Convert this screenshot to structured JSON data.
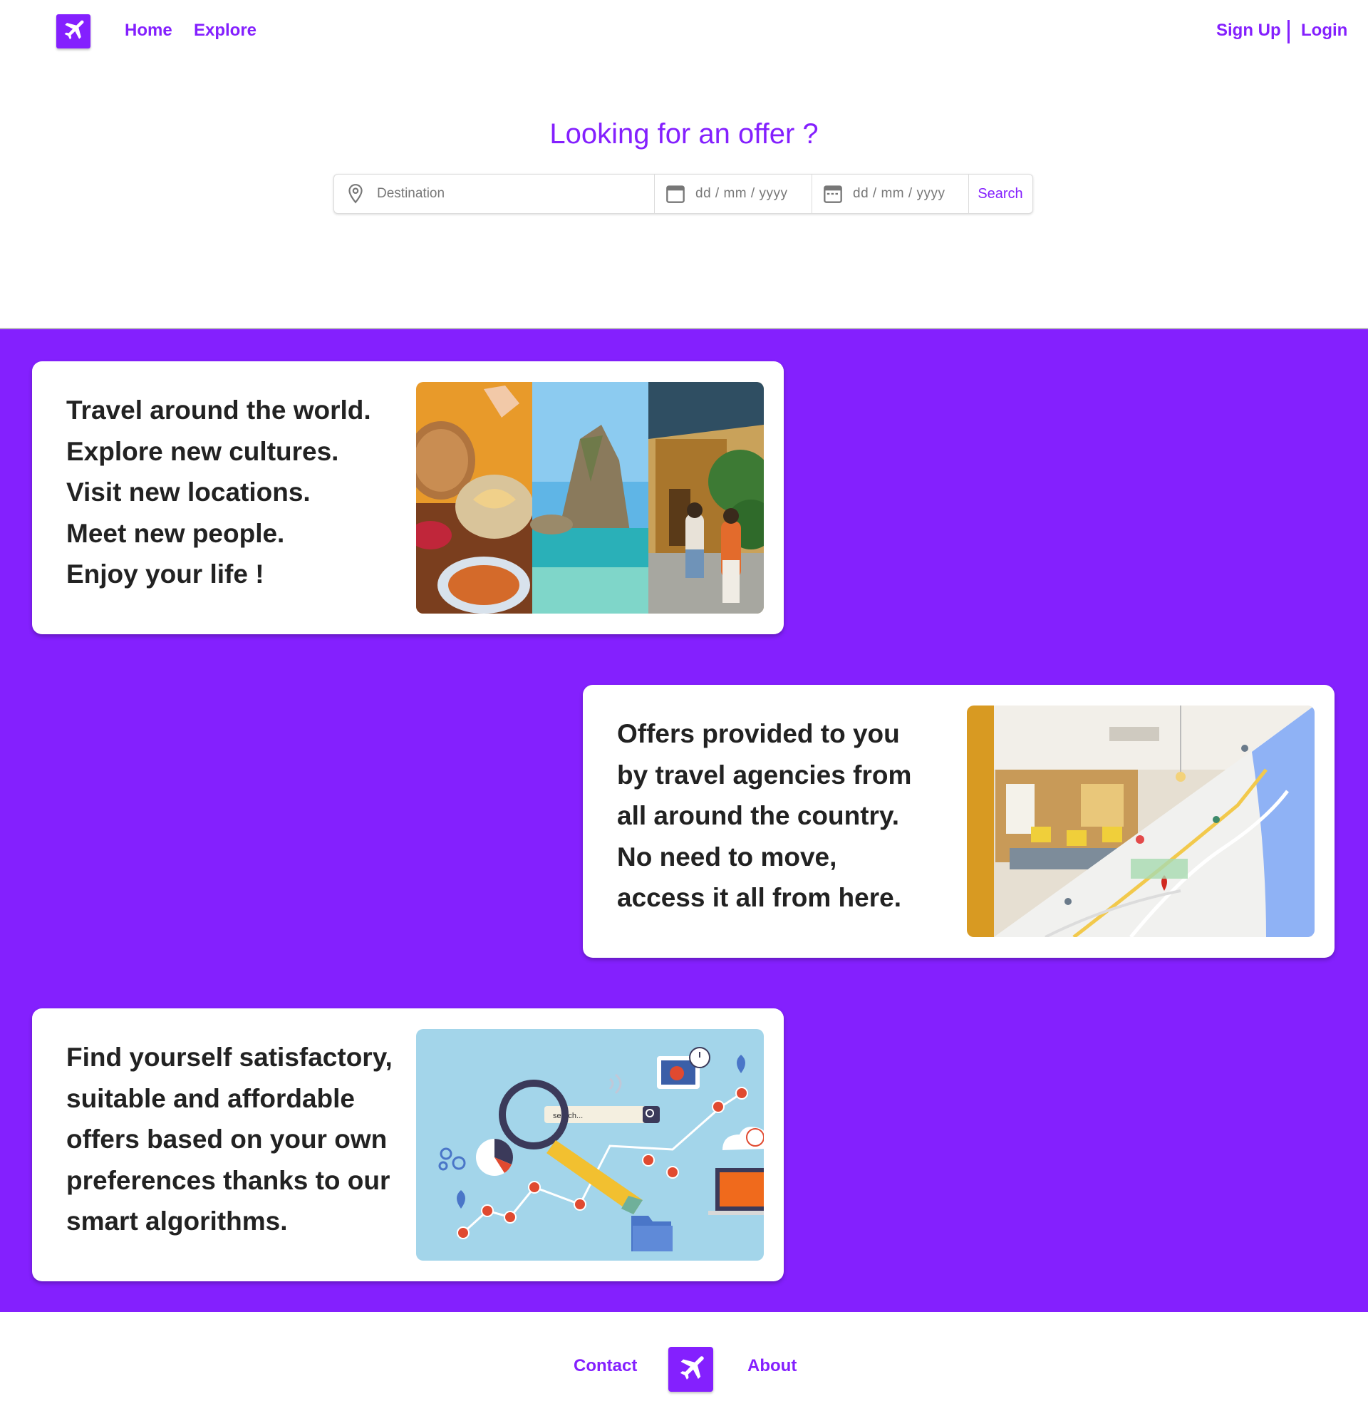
{
  "header": {
    "logo_icon": "airplane-icon",
    "nav": [
      {
        "label": "Home"
      },
      {
        "label": "Explore"
      }
    ],
    "signup_label": "Sign Up",
    "login_label": "Login"
  },
  "hero": {
    "title": "Looking for an offer ?",
    "search": {
      "destination_placeholder": "Destination",
      "start_date_placeholder": "dd / mm / yyyy",
      "end_date_placeholder": "dd / mm / yyyy",
      "button_label": "Search",
      "destination_icon": "location-pin-icon",
      "start_date_icon": "calendar-icon",
      "end_date_icon": "calendar-range-icon"
    }
  },
  "features": [
    {
      "lines": [
        "Travel around the world.",
        "Explore new cultures.",
        "Visit new locations.",
        "Meet new people.",
        "Enjoy your life !"
      ],
      "image": "collage-food-coast-temple"
    },
    {
      "lines": [
        "Offers provided to you",
        "by travel agencies from",
        "all around the country.",
        "No need to move,",
        "access it all from here."
      ],
      "image": "agency-office-and-map"
    },
    {
      "lines": [
        "Find yourself satisfactory,",
        "suitable and affordable",
        "offers based on your own",
        "preferences thanks to our",
        "smart algorithms."
      ],
      "image": "search-analytics-illustration",
      "illustration_search_text": "search..."
    }
  ],
  "footer": {
    "contact_label": "Contact",
    "about_label": "About",
    "logo_icon": "airplane-icon"
  },
  "colors": {
    "brand": "#8420fe",
    "text": "#222222",
    "background": "#ffffff"
  }
}
